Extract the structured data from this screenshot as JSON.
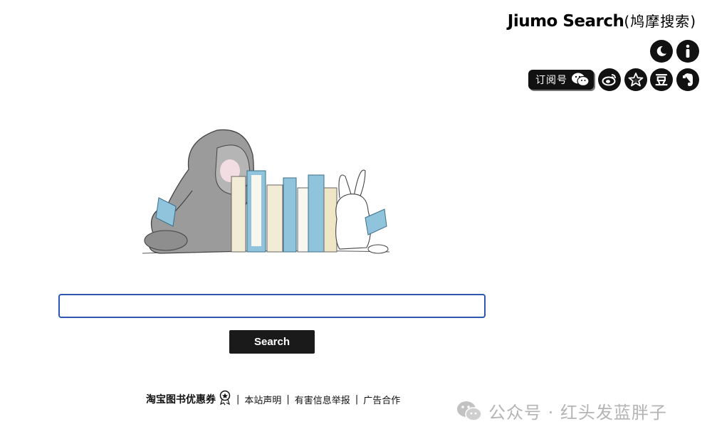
{
  "header": {
    "brand_en": "Jiumo Search",
    "brand_cn": "(鸠摩搜索)"
  },
  "icons": {
    "theme": "moon-icon",
    "info": "info-icon",
    "subscribe_label": "订阅号",
    "wechat": "wechat-icon",
    "weibo": "weibo-icon",
    "star": "star-icon",
    "douban": "豆",
    "evernote": "evernote-icon"
  },
  "search": {
    "placeholder": "",
    "value": "",
    "button_label": "Search"
  },
  "footer": {
    "promo": "淘宝图书优惠券",
    "sep": "|",
    "links": [
      "本站声明",
      "有害信息举报",
      "广告合作"
    ]
  },
  "watermark": {
    "text": "公众号 · 红头发蓝胖子"
  },
  "colors": {
    "accent": "#2d57b0",
    "button_bg": "#1a1a1a",
    "book_blue": "#8fc4dc",
    "book_cream": "#f2ecd6"
  }
}
